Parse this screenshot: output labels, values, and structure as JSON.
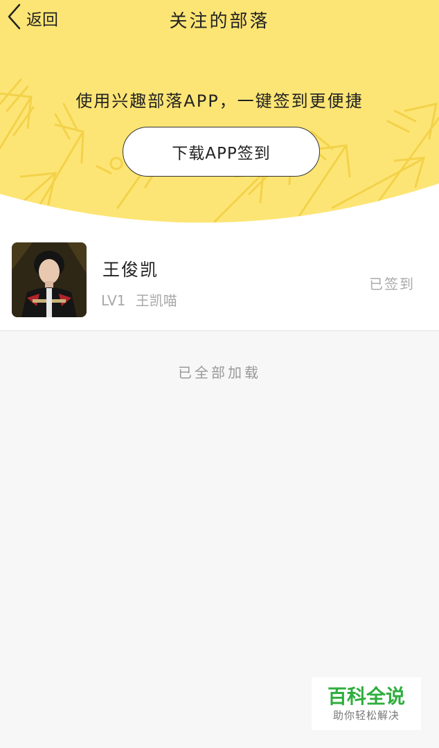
{
  "nav": {
    "back_label": "返回",
    "title": "关注的部落"
  },
  "promo": {
    "text": "使用兴趣部落APP，一键签到更便捷",
    "button_label": "下载APP签到"
  },
  "tribes": [
    {
      "name": "王俊凯",
      "level": "LV1",
      "member_title": "王凯喵",
      "status": "已签到"
    }
  ],
  "list_end_text": "已全部加载",
  "watermark": {
    "title": "百科全说",
    "subtitle": "助你轻松解决"
  },
  "colors": {
    "header_yellow": "#fde575",
    "arrow_pattern": "#f3d24a",
    "background": "#f7f7f7",
    "watermark_green": "#2fae3e"
  }
}
